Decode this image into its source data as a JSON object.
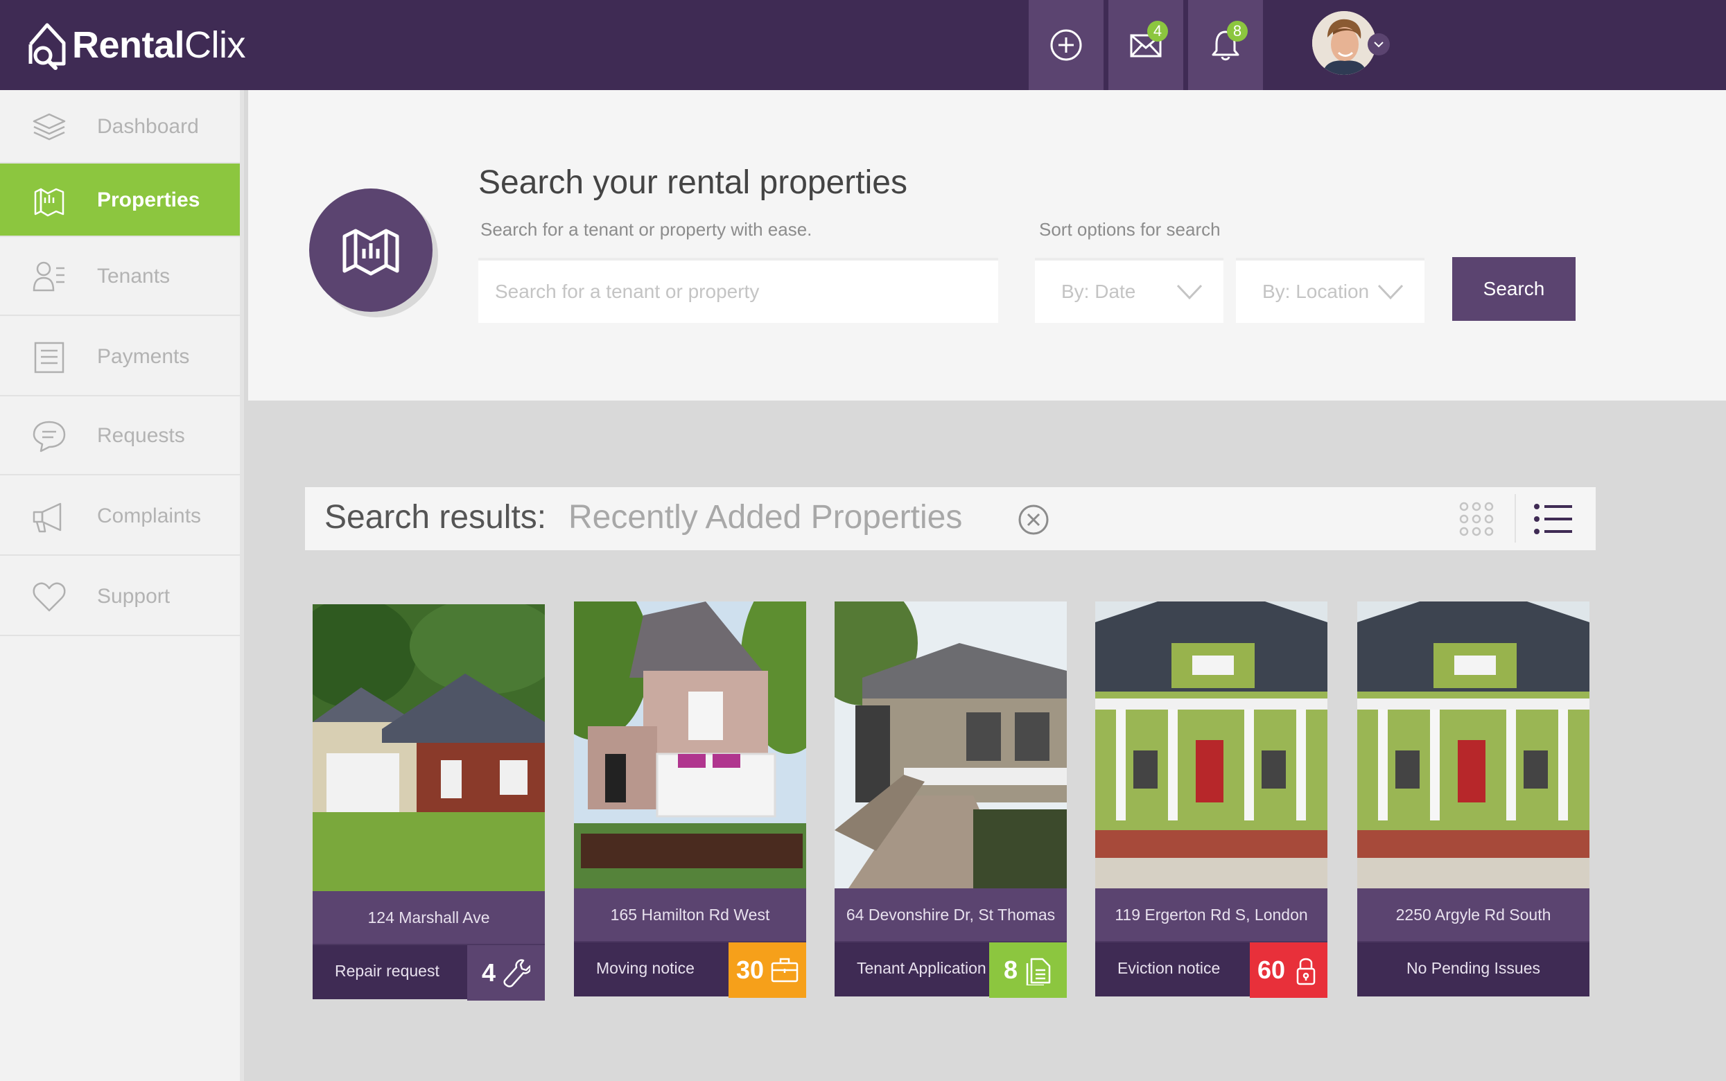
{
  "app": {
    "logo_bold": "Rental",
    "logo_light": "Clix"
  },
  "topbar": {
    "add_icon": "plus-circle-icon",
    "messages_badge": "4",
    "notifications_badge": "8"
  },
  "sidebar": {
    "items": [
      {
        "label": "Dashboard",
        "icon": "layers-icon",
        "active": false
      },
      {
        "label": "Properties",
        "icon": "map-icon",
        "active": true
      },
      {
        "label": "Tenants",
        "icon": "user-list-icon",
        "active": false
      },
      {
        "label": "Payments",
        "icon": "document-lines-icon",
        "active": false
      },
      {
        "label": "Requests",
        "icon": "chat-bubble-icon",
        "active": false
      },
      {
        "label": "Complaints",
        "icon": "megaphone-icon",
        "active": false
      },
      {
        "label": "Support",
        "icon": "heart-icon",
        "active": false
      }
    ]
  },
  "search": {
    "title": "Search your rental properties",
    "subtitle": "Search for a tenant or property with ease.",
    "sort_label": "Sort options for search",
    "placeholder": "Search for a tenant or property",
    "sort_date": "By: Date",
    "sort_location": "By: Location",
    "button": "Search"
  },
  "results": {
    "title": "Search results:",
    "query": "Recently Added Properties"
  },
  "properties": [
    {
      "address": "124 Marshall Ave",
      "status": "Repair request",
      "count": "4",
      "status_icon": "wrench-icon",
      "status_color": "#5b4470"
    },
    {
      "address": "165 Hamilton Rd West",
      "status": "Moving notice",
      "count": "30",
      "status_icon": "briefcase-icon",
      "status_color": "#f6a01a"
    },
    {
      "address": "64 Devonshire Dr, St Thomas",
      "status": "Tenant Application",
      "count": "8",
      "status_icon": "documents-icon",
      "status_color": "#8cc63f"
    },
    {
      "address": "119 Ergerton Rd S, London",
      "status": "Eviction notice",
      "count": "60",
      "status_icon": "lock-icon",
      "status_color": "#e8303a"
    },
    {
      "address": "2250 Argyle Rd South",
      "status": "No Pending Issues",
      "count": "",
      "status_icon": "",
      "status_color": ""
    }
  ],
  "colors": {
    "topbar": "#3f2b54",
    "accent_purple": "#5b4470",
    "active_green": "#8cc63f",
    "orange": "#f6a01a",
    "red": "#e8303a"
  }
}
